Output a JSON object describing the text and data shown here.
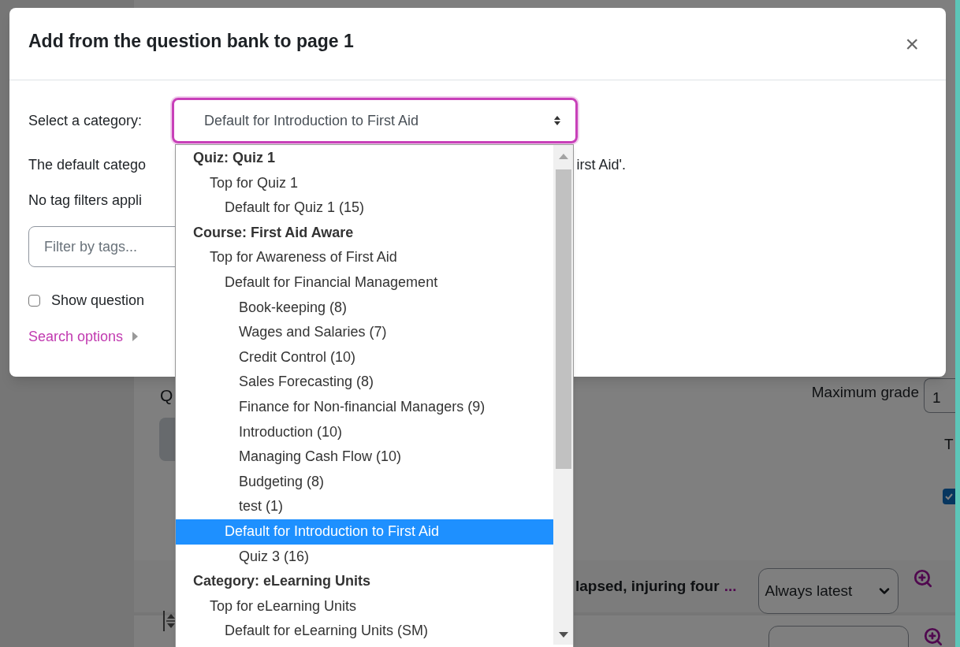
{
  "page": {
    "heading_fragment": "Q",
    "max_grade_label": "Maximum grade",
    "max_grade_value": "1",
    "total_fragment": "T",
    "select_all_checked": true,
    "question_row": {
      "name_fragment": "lapsed, injuring four",
      "ellipsis": "...",
      "version": "Always latest"
    }
  },
  "dialog": {
    "title": "Add from the question bank to page 1",
    "close": "×",
    "category_label": "Select a category:",
    "category_value": "Default for Introduction to First Aid",
    "info_left": "The default catego",
    "info_right": "irst Aid'.",
    "tags_note": "No tag filters appli",
    "tag_filter": {
      "placeholder": "Filter by tags..."
    },
    "show_question_text": {
      "label": "Show question",
      "checked": false
    },
    "search_options": "Search options"
  },
  "category_list": [
    {
      "kind": "group",
      "label": "Quiz: Quiz 1",
      "children": [
        {
          "label": "Top for Quiz 1",
          "selected": false,
          "children": [
            {
              "label": "Default for Quiz 1 (15)",
              "selected": false
            }
          ]
        }
      ]
    },
    {
      "kind": "group",
      "label": "Course: First Aid Aware",
      "children": [
        {
          "label": "Top for Awareness of First Aid",
          "selected": false,
          "children": [
            {
              "label": "Default for Financial Management",
              "selected": false,
              "children": [
                {
                  "label": "Book-keeping (8)",
                  "selected": false
                },
                {
                  "label": "Wages and Salaries (7)",
                  "selected": false
                },
                {
                  "label": "Credit Control (10)",
                  "selected": false
                },
                {
                  "label": "Sales Forecasting (8)",
                  "selected": false
                },
                {
                  "label": "Finance for Non-financial Managers (9)",
                  "selected": false
                },
                {
                  "label": "Introduction (10)",
                  "selected": false
                },
                {
                  "label": "Managing Cash Flow (10)",
                  "selected": false
                },
                {
                  "label": "Budgeting (8)",
                  "selected": false
                },
                {
                  "label": "test (1)",
                  "selected": false
                }
              ]
            },
            {
              "label": "Default for Introduction to First Aid",
              "selected": true,
              "children": [
                {
                  "label": "Quiz 3 (16)",
                  "selected": false
                }
              ]
            }
          ]
        }
      ]
    },
    {
      "kind": "group",
      "label": "Category: eLearning Units",
      "children": [
        {
          "label": "Top for eLearning Units",
          "selected": false,
          "children": [
            {
              "label": "Default for eLearning Units (SM)",
              "selected": false
            }
          ]
        }
      ]
    }
  ]
}
